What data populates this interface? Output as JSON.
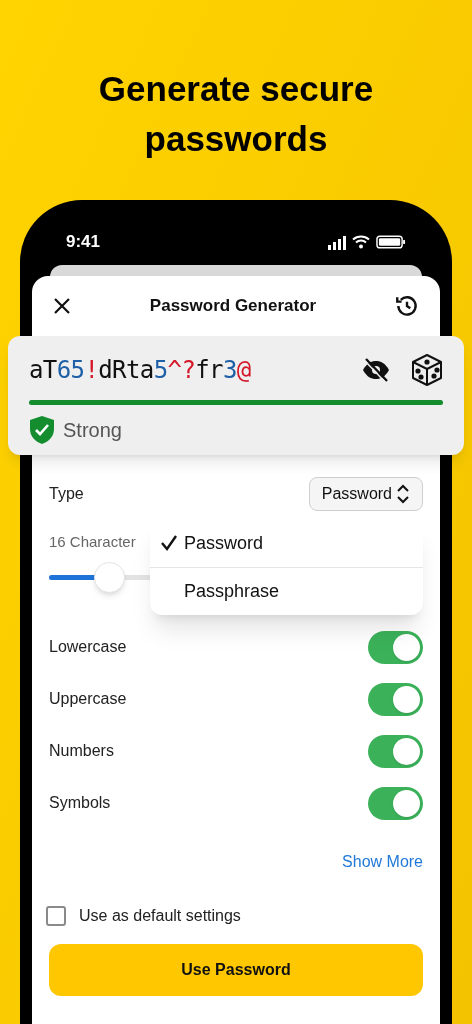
{
  "headline": "Generate secure passwords",
  "status_bar": {
    "time": "9:41"
  },
  "header": {
    "title": "Password Generator"
  },
  "password": {
    "segments": [
      {
        "text": "aT",
        "kind": "letter"
      },
      {
        "text": "65",
        "kind": "number"
      },
      {
        "text": "!",
        "kind": "symbol"
      },
      {
        "text": "dRta",
        "kind": "letter"
      },
      {
        "text": "5",
        "kind": "number"
      },
      {
        "text": "^?",
        "kind": "symbol"
      },
      {
        "text": "fr",
        "kind": "letter"
      },
      {
        "text": "3",
        "kind": "number"
      },
      {
        "text": "@",
        "kind": "symbol"
      }
    ],
    "strength": {
      "label": "Strong",
      "level": 1,
      "color": "#138d2e"
    }
  },
  "type": {
    "label": "Type",
    "value": "Password"
  },
  "dropdown": [
    {
      "label": "Password",
      "selected": true
    },
    {
      "label": "Passphrase",
      "selected": false
    }
  ],
  "length": {
    "label": "16 Character",
    "level": 0.16
  },
  "options": [
    {
      "label": "Lowercase",
      "on": true
    },
    {
      "label": "Uppercase",
      "on": true
    },
    {
      "label": "Numbers",
      "on": true
    },
    {
      "label": "Symbols",
      "on": true
    }
  ],
  "show_more": "Show More",
  "default_settings": {
    "label": "Use as default settings",
    "checked": false
  },
  "primary_button": "Use Password"
}
